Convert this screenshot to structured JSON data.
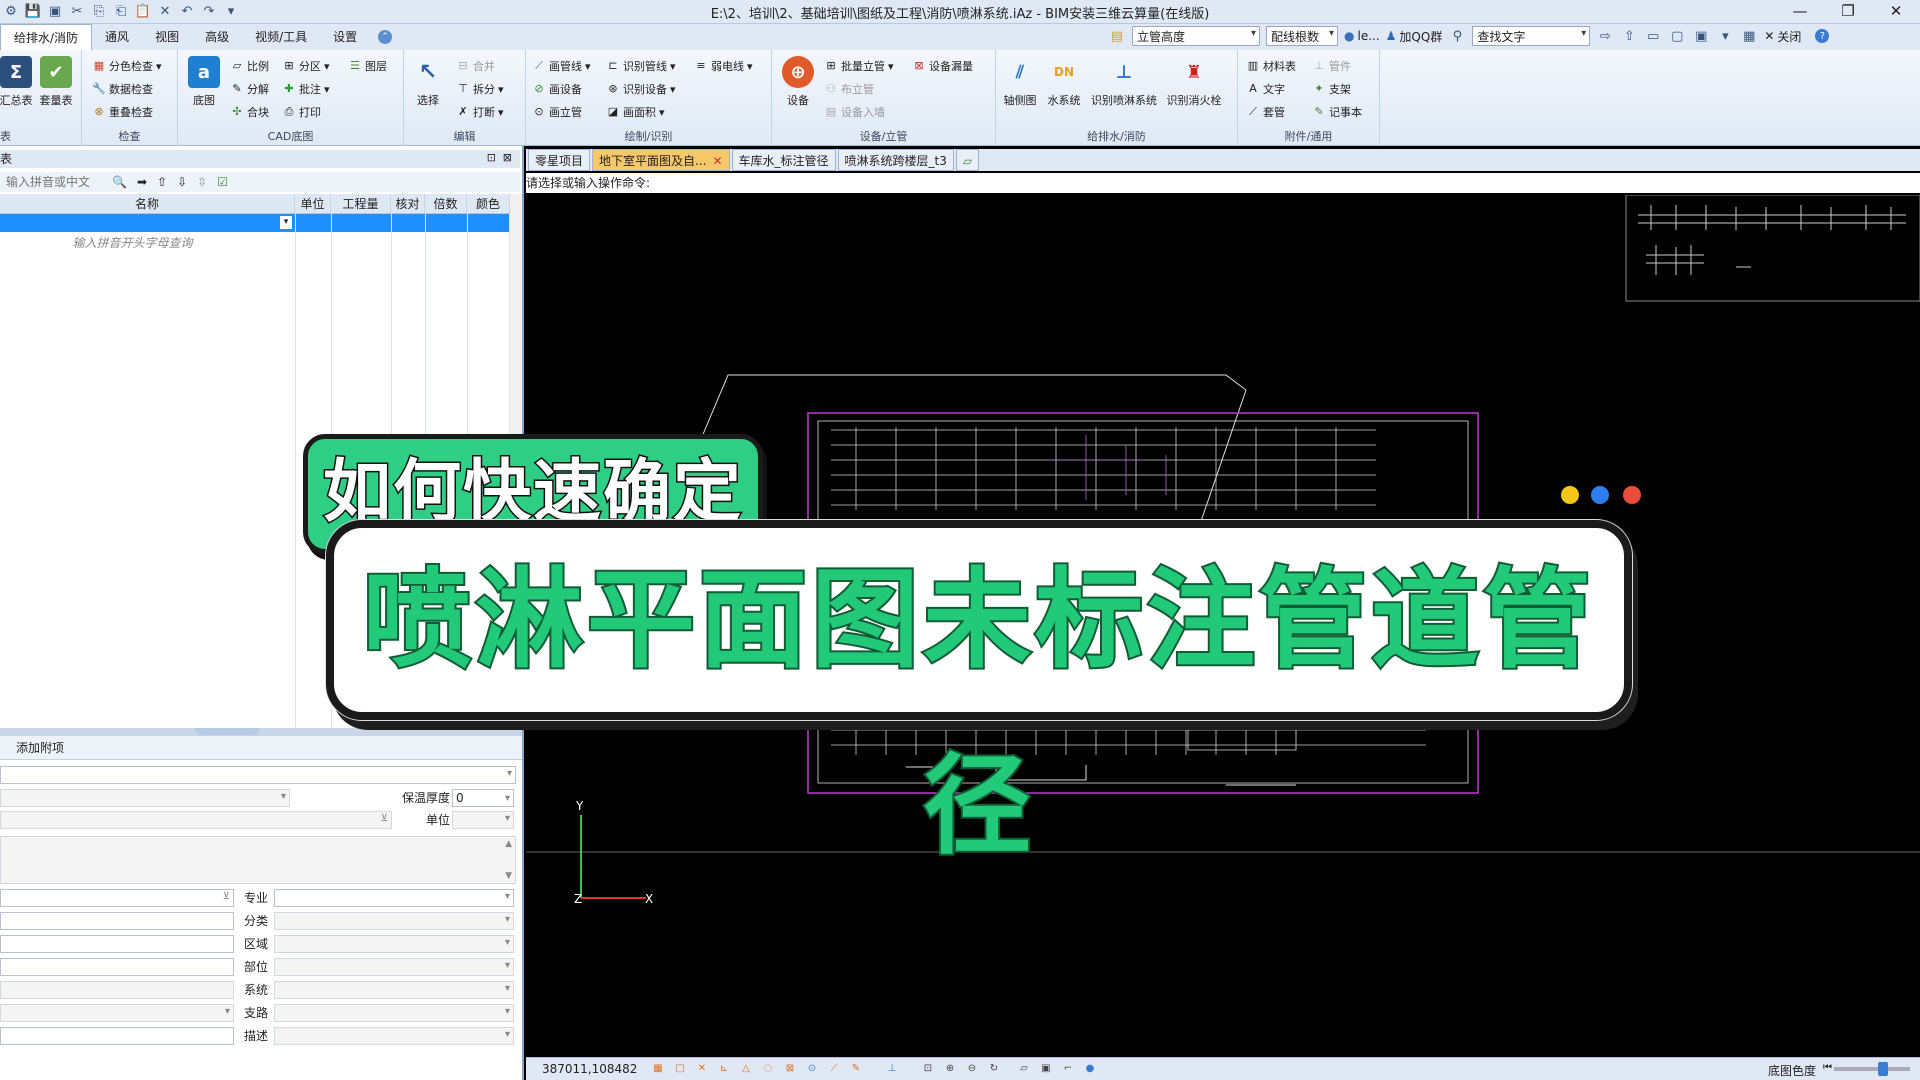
{
  "window": {
    "title": "E:\\2、培训\\2、基础培训\\图纸及工程\\消防\\喷淋系统.iAz - BIM安装三维云算量(在线版)",
    "controls": [
      "—",
      "❐",
      "✕"
    ]
  },
  "menu": {
    "tabs": [
      "给排水/消防",
      "通风",
      "视图",
      "高级",
      "视频/工具",
      "设置"
    ],
    "active": "给排水/消防"
  },
  "topright": {
    "height_select": "立管高度",
    "wiring_select": "配线根数",
    "user": "le...",
    "qq": "加QQ群",
    "find_text": "查找文字",
    "close": "关闭"
  },
  "ribbon": {
    "groups": {
      "g1": {
        "label": "表",
        "items": [
          "汇总表",
          "套量表"
        ]
      },
      "check": {
        "label": "检查",
        "items": [
          "分色检查",
          "数据检查",
          "重叠检查"
        ]
      },
      "cad": {
        "label": "CAD底图",
        "big": "底图",
        "items": [
          "比例",
          "分区",
          "图层",
          "分解",
          "批注",
          "合块",
          "打印"
        ]
      },
      "edit": {
        "label": "编辑",
        "big": "选择",
        "items": [
          "合并",
          "拆分",
          "打断"
        ]
      },
      "draw": {
        "label": "绘制/识别",
        "items": [
          "画管线",
          "识别管线",
          "弱电线",
          "画设备",
          "识别设备",
          "画立管",
          "画面积"
        ]
      },
      "equip": {
        "label": "设备/立管",
        "big": "设备",
        "items": [
          "批量立管",
          "设备漏量",
          "布立管",
          "设备入墙"
        ]
      },
      "water": {
        "label": "给排水/消防",
        "items": [
          "轴侧图",
          "水系统",
          "识别喷淋系统",
          "识别消火栓"
        ]
      },
      "attach": {
        "label": "附件/通用",
        "items": [
          "材料表",
          "管件",
          "文字",
          "支架",
          "套管",
          "记事本"
        ]
      }
    }
  },
  "left_panel": {
    "header": "表",
    "search_placeholder": "输入拼音或中文",
    "columns": [
      "名称",
      "单位",
      "工程量",
      "核对",
      "倍数",
      "颜色"
    ],
    "hint": "输入拼音开头字母查询",
    "props_tab": "添加附项",
    "props": {
      "insulation_label": "保温厚度",
      "insulation_value": "0",
      "unit_label": "单位",
      "major_label": "专业",
      "category_label": "分类",
      "area_label": "区域",
      "part_label": "部位",
      "system_label": "系统",
      "branch_label": "支路",
      "desc_label": "描述"
    }
  },
  "doc_tabs": {
    "items": [
      "零星项目",
      "地下室平面图及自...",
      "车库水_标注管径",
      "喷淋系统跨楼层_t3"
    ],
    "active_index": 1,
    "close_glyph": "✕"
  },
  "command_prompt": "请选择或输入操作命令:",
  "statusbar": {
    "coords": "387011,108482",
    "bg_color_label": "底图色度"
  },
  "axis": {
    "y": "Y",
    "z": "Z",
    "x": "X"
  },
  "overlay": {
    "title_top": "如何快速确定",
    "title_main": "喷淋平面图未标注管道管径",
    "dots": [
      "#f5c518",
      "#2f7ef0",
      "#ea4b3a"
    ]
  },
  "colors": {
    "accent_green": "#21c978",
    "selection_blue": "#1e90ff",
    "active_tab": "#f7c86a"
  }
}
